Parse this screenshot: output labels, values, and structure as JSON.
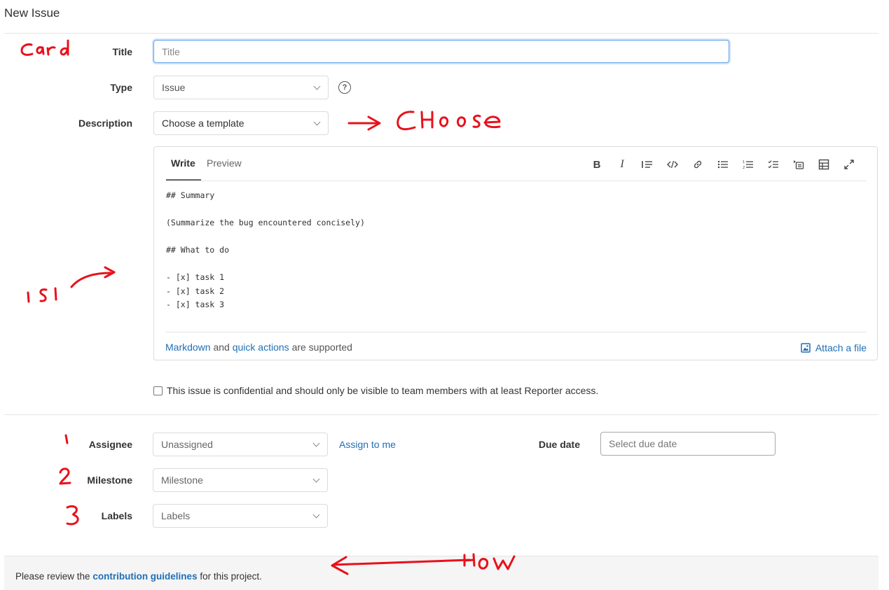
{
  "page": {
    "title": "New Issue"
  },
  "form": {
    "title_label": "Title",
    "title_placeholder": "Title",
    "type_label": "Type",
    "type_value": "Issue",
    "description_label": "Description",
    "template_value": "Choose a template",
    "help_icon": "question-circle-icon"
  },
  "editor": {
    "tabs": [
      "Write",
      "Preview"
    ],
    "toolbar_icons": [
      "bold-icon",
      "italic-icon",
      "quote-icon",
      "code-icon",
      "link-icon",
      "bullet-list-icon",
      "numbered-list-icon",
      "task-list-icon",
      "collapsible-icon",
      "table-icon",
      "fullscreen-icon"
    ],
    "content": "## Summary\n\n(Summarize the bug encountered concisely)\n\n## What to do\n\n- [x] task 1\n- [x] task 2\n- [x] task 3",
    "footer_markdown": "Markdown",
    "footer_and": "and",
    "footer_quick_actions": "quick actions",
    "footer_supported": "are supported",
    "attach_label": "Attach a file"
  },
  "confidential": {
    "label": "This issue is confidential and should only be visible to team members with at least Reporter access.",
    "checked": false
  },
  "sidebar_fields": {
    "assignee_label": "Assignee",
    "assignee_value": "Unassigned",
    "assign_to_me": "Assign to me",
    "due_date_label": "Due date",
    "due_date_placeholder": "Select due date",
    "milestone_label": "Milestone",
    "milestone_value": "Milestone",
    "labels_label": "Labels",
    "labels_value": "Labels"
  },
  "footer": {
    "prefix": "Please review the",
    "link": "contribution guidelines",
    "suffix": "for this project."
  },
  "annotations": {
    "card": "Card",
    "choose": "Choose",
    "isi": "ISI",
    "n1": "1",
    "n2": "2",
    "n3": "3",
    "how": "How"
  },
  "colors": {
    "link": "#1f6fb7",
    "annotation": "#e8111b",
    "focus_border": "#63a6e9"
  }
}
